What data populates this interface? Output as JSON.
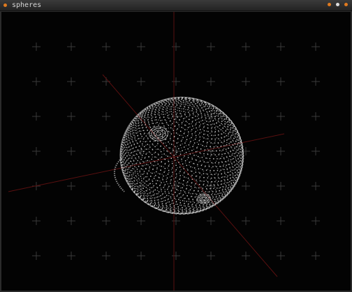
{
  "window": {
    "title": "spheres",
    "accent_color": "#e07a1f",
    "controls": [
      {
        "name": "minimize",
        "icon": "minimize-icon"
      },
      {
        "name": "maximize",
        "icon": "maximize-icon"
      },
      {
        "name": "close",
        "icon": "close-icon"
      }
    ]
  },
  "scene": {
    "background_color": "#030303",
    "grid_marker_color": "#3a3a3a",
    "axis_color": "#5a1010",
    "point_color": "#e8e8e8",
    "grid_rows": 7,
    "grid_cols": 9
  }
}
